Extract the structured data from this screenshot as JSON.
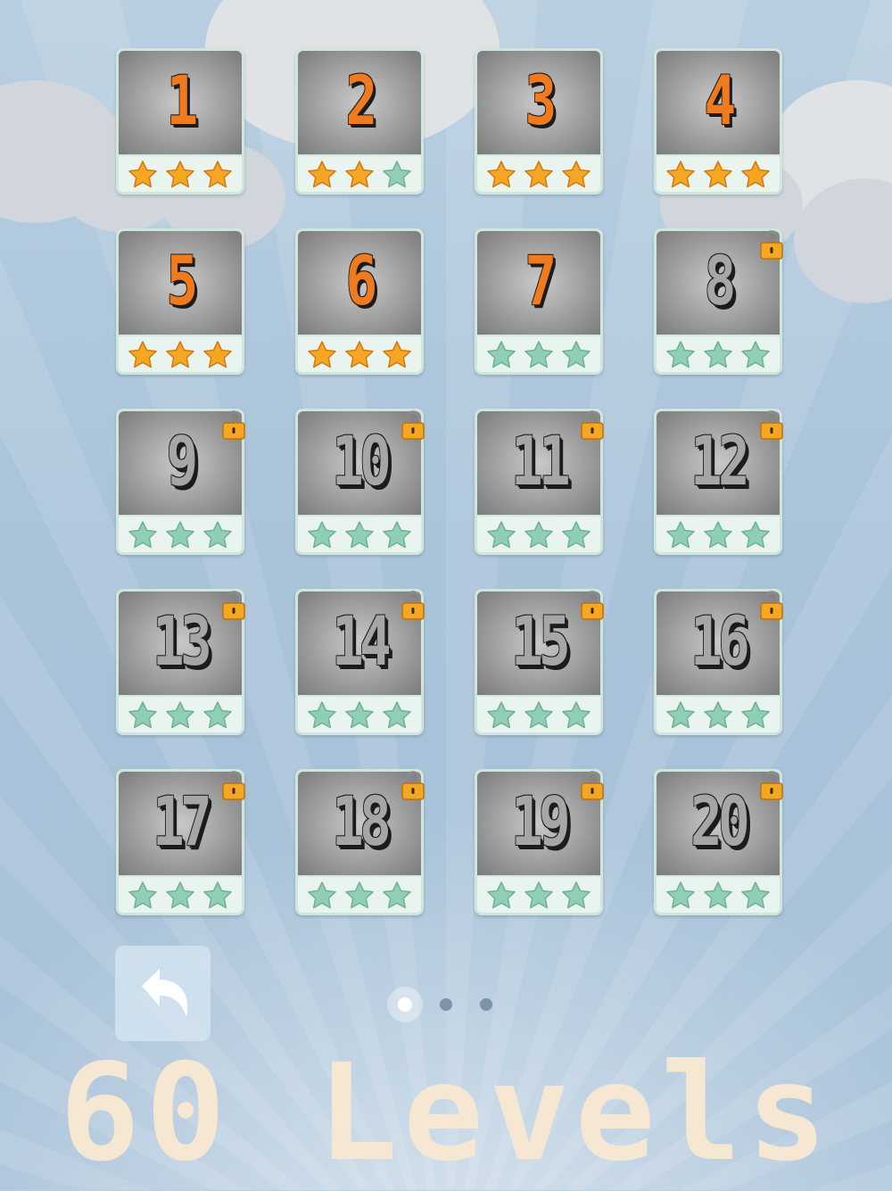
{
  "levels": [
    {
      "number": "1",
      "stars": 3,
      "locked": false
    },
    {
      "number": "2",
      "stars": 2,
      "locked": false
    },
    {
      "number": "3",
      "stars": 3,
      "locked": false
    },
    {
      "number": "4",
      "stars": 3,
      "locked": false
    },
    {
      "number": "5",
      "stars": 3,
      "locked": false
    },
    {
      "number": "6",
      "stars": 3,
      "locked": false
    },
    {
      "number": "7",
      "stars": 0,
      "locked": false
    },
    {
      "number": "8",
      "stars": 0,
      "locked": true
    },
    {
      "number": "9",
      "stars": 0,
      "locked": true
    },
    {
      "number": "10",
      "stars": 0,
      "locked": true
    },
    {
      "number": "11",
      "stars": 0,
      "locked": true
    },
    {
      "number": "12",
      "stars": 0,
      "locked": true
    },
    {
      "number": "13",
      "stars": 0,
      "locked": true
    },
    {
      "number": "14",
      "stars": 0,
      "locked": true
    },
    {
      "number": "15",
      "stars": 0,
      "locked": true
    },
    {
      "number": "16",
      "stars": 0,
      "locked": true
    },
    {
      "number": "17",
      "stars": 0,
      "locked": true
    },
    {
      "number": "18",
      "stars": 0,
      "locked": true
    },
    {
      "number": "19",
      "stars": 0,
      "locked": true
    },
    {
      "number": "20",
      "stars": 0,
      "locked": true
    }
  ],
  "pagination": {
    "pages": 3,
    "current": 1
  },
  "back_button": {
    "icon": "curved-back-arrow-icon"
  },
  "headline": "60 Levels",
  "colors": {
    "star_earned": "#f5a623",
    "star_empty": "#8fcfb6",
    "number_unlocked": "#f07a1e",
    "number_locked": "#a6a6a6",
    "lock": "#f5a623",
    "headline": "#f5e7d2"
  }
}
